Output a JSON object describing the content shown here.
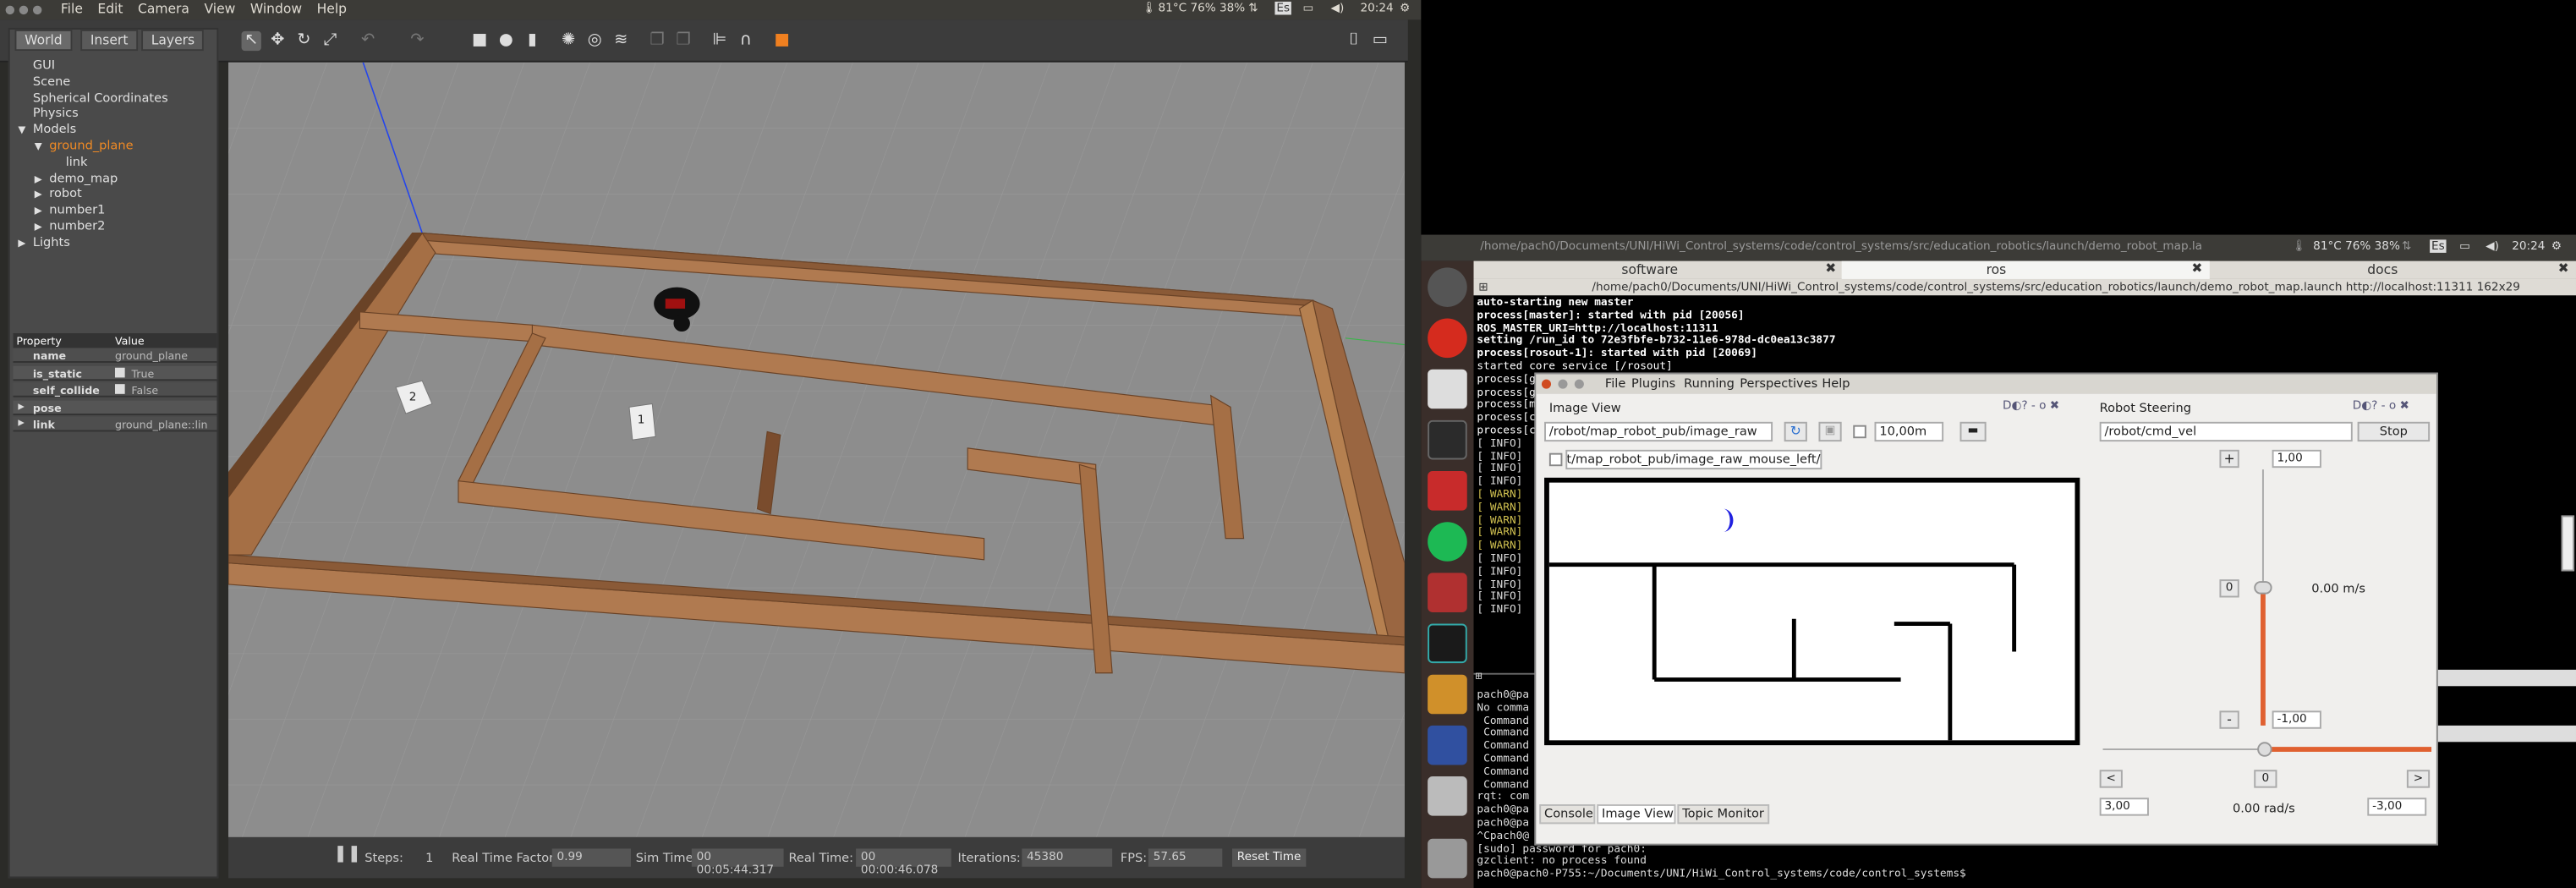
{
  "gazebo": {
    "menu": [
      "File",
      "Edit",
      "Camera",
      "View",
      "Window",
      "Help"
    ],
    "tray": {
      "weather": "81°C 76% 38%",
      "lang": "Es",
      "time": "20:24"
    },
    "tabs": [
      "World",
      "Insert",
      "Layers"
    ],
    "tree": [
      {
        "label": "GUI",
        "indent": 0,
        "arrow": ""
      },
      {
        "label": "Scene",
        "indent": 0,
        "arrow": ""
      },
      {
        "label": "Spherical Coordinates",
        "indent": 0,
        "arrow": ""
      },
      {
        "label": "Physics",
        "indent": 0,
        "arrow": ""
      },
      {
        "label": "Models",
        "indent": 0,
        "arrow": "▼"
      },
      {
        "label": "ground_plane",
        "indent": 1,
        "arrow": "▼",
        "selected": true
      },
      {
        "label": "link",
        "indent": 2,
        "arrow": ""
      },
      {
        "label": "demo_map",
        "indent": 1,
        "arrow": "▶"
      },
      {
        "label": "robot",
        "indent": 1,
        "arrow": "▶"
      },
      {
        "label": "number1",
        "indent": 1,
        "arrow": "▶"
      },
      {
        "label": "number2",
        "indent": 1,
        "arrow": "▶"
      },
      {
        "label": "Lights",
        "indent": 0,
        "arrow": "▶"
      }
    ],
    "props": {
      "header_property": "Property",
      "header_value": "Value",
      "rows": [
        {
          "k": "name",
          "v": "ground_plane",
          "arrow": ""
        },
        {
          "k": "is_static",
          "v": "True",
          "arrow": "",
          "check": true
        },
        {
          "k": "self_collide",
          "v": "False",
          "arrow": "",
          "check": true
        },
        {
          "k": "pose",
          "v": "",
          "arrow": "▶"
        },
        {
          "k": "link",
          "v": "ground_plane::link",
          "arrow": "▶"
        }
      ]
    },
    "bottom": {
      "steps_label": "Steps:",
      "steps": "1",
      "rtf_label": "Real Time Factor:",
      "rtf": "0.99",
      "sim_label": "Sim Time:",
      "sim": "00 00:05:44.317",
      "real_label": "Real Time:",
      "real": "00 00:00:46.078",
      "iter_label": "Iterations:",
      "iter": "45380",
      "fps_label": "FPS:",
      "fps": "57.65",
      "reset": "Reset Time"
    }
  },
  "desktop2": {
    "title": "/home/pach0/Documents/UNI/HiWi_Control_systems/code/control_systems/src/education_robotics/launch/demo_robot_map.la",
    "tray": "81°C 76% 38%",
    "lang": "Es",
    "time": "20:24",
    "term_tabs": [
      "software",
      "ros",
      "docs"
    ],
    "term_path": "/home/pach0/Documents/UNI/HiWi_Control_systems/code/control_systems/src/education_robotics/launch/demo_robot_map.launch http://localhost:11311 162x29",
    "term_lines": [
      "auto-starting new master",
      "process[master]: started with pid [20056]",
      "ROS_MASTER_URI=http://localhost:11311",
      "",
      "setting /run_id to 72e3fbfe-b732-11e6-978d-dc0ea13c3877",
      "process[rosout-1]: started with pid [20069]",
      "started core service [/rosout]",
      "process[g",
      "process[g",
      "process[m",
      "process[c",
      "process[c",
      "[ INFO]",
      "[ INFO]",
      "[ INFO]",
      "[ INFO]",
      "[ WARN]",
      "[ WARN]",
      "[ WARN]",
      "[ WARN]",
      "[ WARN]",
      "[ INFO]",
      "[ INFO]",
      "[ INFO]",
      "[ INFO]",
      "[ INFO]"
    ],
    "term2_lines": [
      "pach0@pa",
      "No comma",
      " Command",
      " Command",
      " Command",
      " Command",
      " Command",
      " Command",
      "rqt: com",
      "pach0@pa",
      "pach0@pa",
      "^Cpach0@",
      "[sudo] password for pach0:",
      "gzclient: no process found",
      "pach0@pach0-P755:~/Documents/UNI/HiWi_Control_systems/code/control_systems$ "
    ]
  },
  "rqt": {
    "menu": [
      "File",
      "Plugins",
      "Running",
      "Perspectives",
      "Help"
    ],
    "image_view": {
      "title": "Image View",
      "topic": "/robot/map_robot_pub/image_raw",
      "zoom": "10,00m",
      "mouse_topic": "/robot/map_robot_pub/image_raw_mouse_left"
    },
    "steering": {
      "title": "Robot Steering",
      "topic": "/robot/cmd_vel",
      "stop": "Stop",
      "lin_max": "1,00",
      "lin_min": "-1,00",
      "lin_zero": "0",
      "lin_value": "0.00 m/s",
      "ang_left": "3,00",
      "ang_right": "-3,00",
      "ang_zero": "0",
      "ang_value": "0.00 rad/s",
      "plus": "+",
      "minus": "-",
      "lt": "<",
      "gt": ">"
    },
    "bottom_tabs": [
      "Console",
      "Image View",
      "Topic Monitor"
    ]
  }
}
